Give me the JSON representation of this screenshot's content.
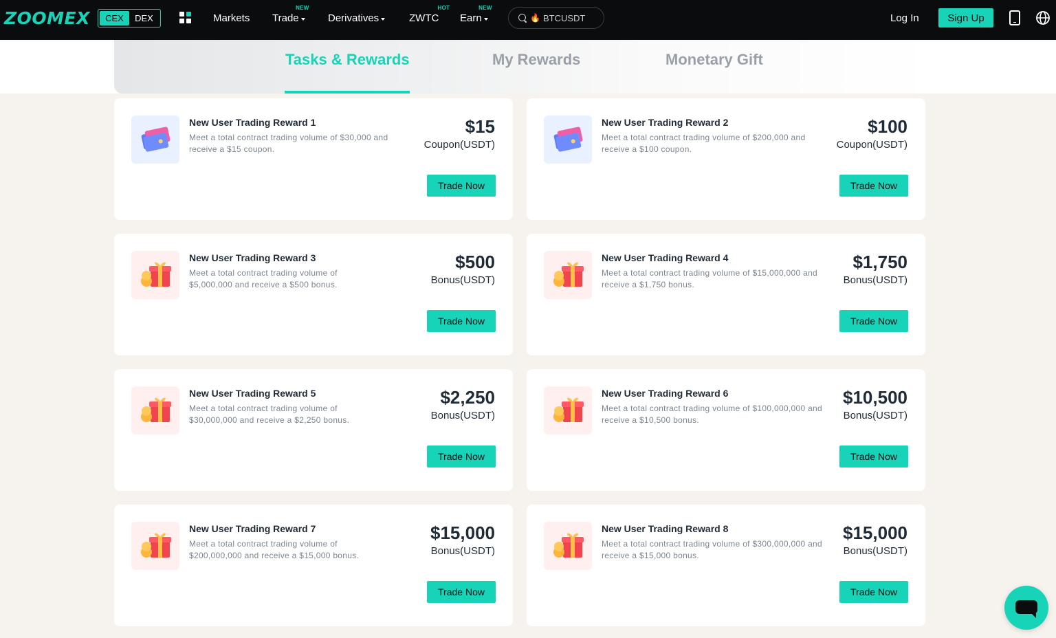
{
  "brand": {
    "logo": "ZOOMEX",
    "accent": "#17d3b8"
  },
  "mode_switch": {
    "options": [
      "CEX",
      "DEX"
    ],
    "selected": "CEX"
  },
  "nav": {
    "markets": "Markets",
    "trade": "Trade",
    "trade_badge": "NEW",
    "derivatives": "Derivatives",
    "zwtc": "ZWTC",
    "zwtc_badge": "HOT",
    "earn": "Earn",
    "earn_badge": "NEW"
  },
  "search": {
    "query": "BTCUSDT",
    "icon": "search-icon",
    "flame": "🔥"
  },
  "auth": {
    "login": "Log In",
    "signup": "Sign Up"
  },
  "tabs": [
    {
      "label": "Tasks & Rewards",
      "active": true
    },
    {
      "label": "My Rewards",
      "active": false
    },
    {
      "label": "Monetary Gift",
      "active": false
    }
  ],
  "cards": [
    {
      "title": "New User Trading Reward 1",
      "desc": "Meet a total contract trading volume of $30,000 and receive a $15 coupon.",
      "amount": "$15",
      "unit": "Coupon(USDT)",
      "icon": "coupon-icon",
      "button": "Trade Now"
    },
    {
      "title": "New User Trading Reward 2",
      "desc": "Meet a total contract trading volume of $200,000 and receive a $100 coupon.",
      "amount": "$100",
      "unit": "Coupon(USDT)",
      "icon": "coupon-icon",
      "button": "Trade Now"
    },
    {
      "title": "New User Trading Reward 3",
      "desc": "Meet a total contract trading volume of $5,000,000 and receive a $500 bonus.",
      "amount": "$500",
      "unit": "Bonus(USDT)",
      "icon": "gift-icon",
      "button": "Trade Now"
    },
    {
      "title": "New User Trading Reward 4",
      "desc": "Meet a total contract trading volume of $15,000,000 and receive a $1,750 bonus.",
      "amount": "$1,750",
      "unit": "Bonus(USDT)",
      "icon": "gift-icon",
      "button": "Trade Now"
    },
    {
      "title": "New User Trading Reward 5",
      "desc": "Meet a total contract trading volume of $30,000,000 and receive a $2,250 bonus.",
      "amount": "$2,250",
      "unit": "Bonus(USDT)",
      "icon": "gift-icon",
      "button": "Trade Now"
    },
    {
      "title": "New User Trading Reward 6",
      "desc": "Meet a total contract trading volume of $100,000,000 and receive a $10,500 bonus.",
      "amount": "$10,500",
      "unit": "Bonus(USDT)",
      "icon": "gift-icon",
      "button": "Trade Now"
    },
    {
      "title": "New User Trading Reward 7",
      "desc": "Meet a total contract trading volume of $200,000,000 and receive a $15,000 bonus.",
      "amount": "$15,000",
      "unit": "Bonus(USDT)",
      "icon": "gift-icon",
      "button": "Trade Now"
    },
    {
      "title": "New User Trading Reward 8",
      "desc": "Meet a total contract trading volume of $300,000,000 and receive a $15,000 bonus.",
      "amount": "$15,000",
      "unit": "Bonus(USDT)",
      "icon": "gift-icon",
      "button": "Trade Now"
    }
  ]
}
